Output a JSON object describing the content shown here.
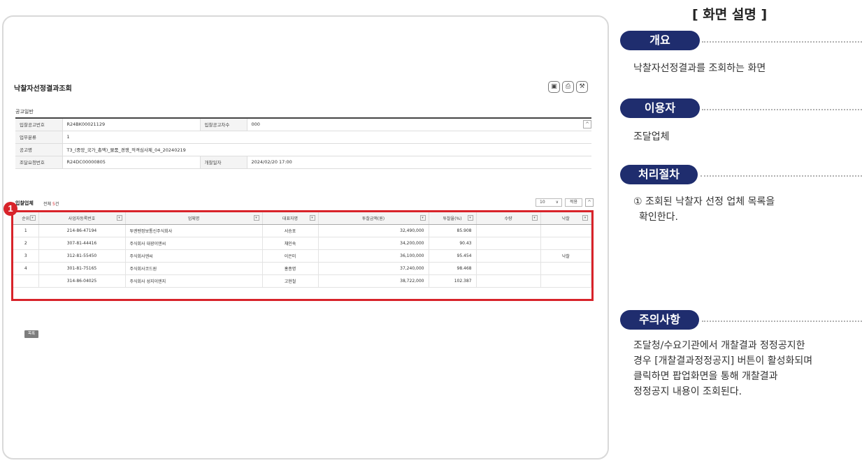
{
  "screen": {
    "page_title": "낙찰자선정결과조회",
    "icons": [
      "floppy-icon",
      "print-icon",
      "wrench-icon"
    ],
    "notice_section_label": "공고일반",
    "info_rows": [
      {
        "label1": "입찰공고번호",
        "value1": "R24BK00021129",
        "label2": "입찰공고차수",
        "value2": "000"
      },
      {
        "label1": "업무분류",
        "value1": "1"
      },
      {
        "label1": "공고명",
        "value1": "T3_(중앙_국가_총액)_물품_경쟁_적격심사제_04_20240219"
      },
      {
        "label1": "조달요청번호",
        "value1": "R24DC00000805",
        "label2": "개찰일자",
        "value2": "2024/02/20 17:00"
      }
    ],
    "bidders_title": "입찰업체",
    "bidders_count_prefix": "전체",
    "bidders_count_num": "5",
    "bidders_count_suffix": "건",
    "page_size": "10",
    "apply_label": "적용",
    "columns": [
      "순위",
      "사업자등록번호",
      "업체명",
      "대표자명",
      "투찰금액(원)",
      "투찰율(%)",
      "수량",
      "낙찰"
    ],
    "rows": [
      {
        "rank": "1",
        "bizno": "214-86-47194",
        "company": "투엔텐정보통신주식회사",
        "ceo": "서승포",
        "amount": "32,490,000",
        "rate": "85.908",
        "qty": "",
        "award": ""
      },
      {
        "rank": "2",
        "bizno": "307-81-44416",
        "company": "주식회사 대광이앤씨",
        "ceo": "채인숙",
        "amount": "34,200,000",
        "rate": "90.43",
        "qty": "",
        "award": ""
      },
      {
        "rank": "3",
        "bizno": "312-81-55450",
        "company": "주식회사엔씨",
        "ceo": "이은미",
        "amount": "36,100,000",
        "rate": "95.454",
        "qty": "",
        "award": "낙찰"
      },
      {
        "rank": "4",
        "bizno": "301-81-75165",
        "company": "주식회사코드원",
        "ceo": "홍종명",
        "amount": "37,240,000",
        "rate": "98.468",
        "qty": "",
        "award": ""
      },
      {
        "rank": "",
        "bizno": "314-86-04025",
        "company": "주식회사 성지이엔지",
        "ceo": "고현철",
        "amount": "38,722,000",
        "rate": "102.387",
        "qty": "",
        "award": ""
      }
    ],
    "marker_number": "1",
    "list_button": "목록"
  },
  "description": {
    "title": "[ 화면 설명 ]",
    "overview_label": "개요",
    "overview_text": "낙찰자선정결과를 조회하는 화면",
    "user_label": "이용자",
    "user_text": "조달업체",
    "procedure_label": "처리절차",
    "procedure_line1": "① 조회된 낙찰자 선정 업체 목록을",
    "procedure_line2": "확인한다.",
    "caution_label": "주의사항",
    "caution_line1": "조달청/수요기관에서 개찰결과 정정공지한",
    "caution_line2": "경우 [개찰결과정정공지] 버튼이 활성화되며",
    "caution_line3": "클릭하면 팝업화면을 통해 개찰결과",
    "caution_line4": "정정공지 내용이 조회된다.",
    "accent_color": "#1f2d6e",
    "highlight_color": "#d8232a"
  }
}
